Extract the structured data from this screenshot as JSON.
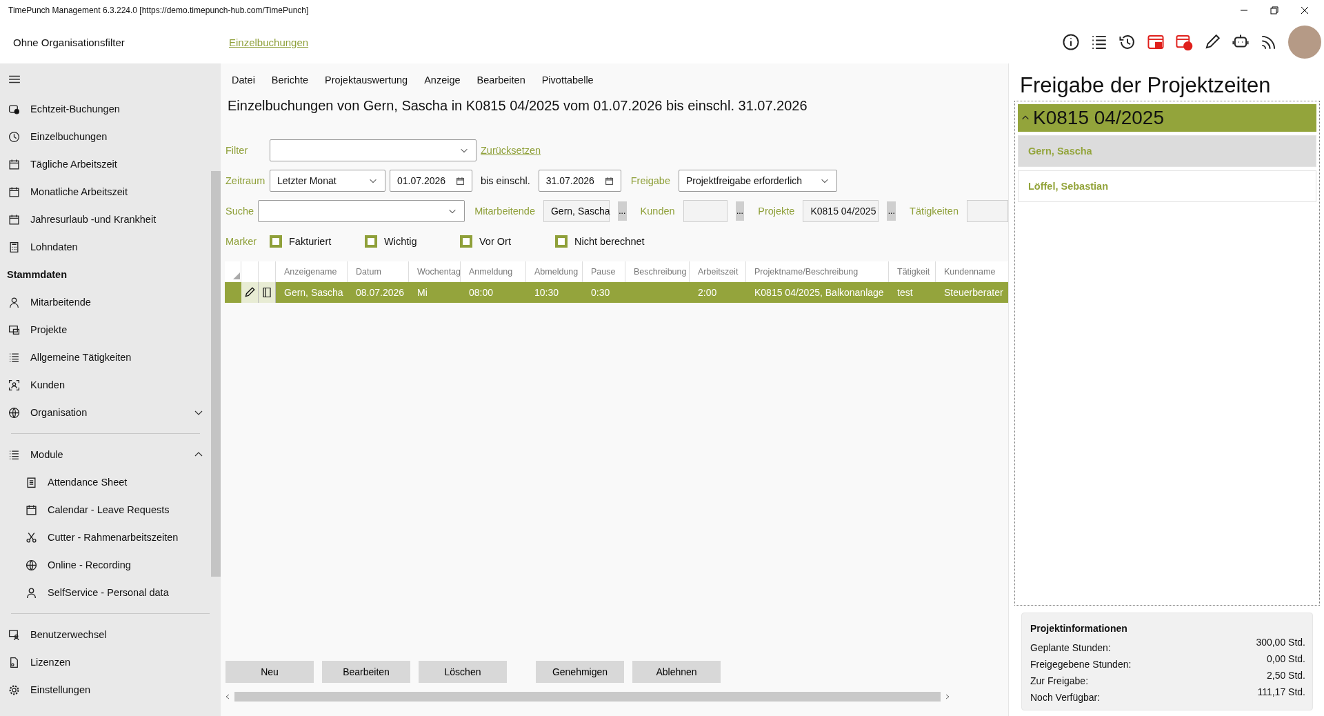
{
  "window": {
    "title": "TimePunch Management 6.3.224.0 [https://demo.timepunch-hub.com/TimePunch]"
  },
  "header": {
    "org_filter": "Ohne Organisationsfilter",
    "breadcrumb": "Einzelbuchungen"
  },
  "sidebar": {
    "items": [
      {
        "kind": "item",
        "label": "Echtzeit-Buchungen"
      },
      {
        "kind": "item",
        "label": "Einzelbuchungen"
      },
      {
        "kind": "item",
        "label": "Tägliche Arbeitszeit"
      },
      {
        "kind": "item",
        "label": "Monatliche Arbeitszeit"
      },
      {
        "kind": "item",
        "label": "Jahresurlaub -und Krankheit"
      },
      {
        "kind": "item",
        "label": "Lohndaten"
      },
      {
        "kind": "heading",
        "label": "Stammdaten"
      },
      {
        "kind": "item",
        "label": "Mitarbeitende"
      },
      {
        "kind": "item",
        "label": "Projekte"
      },
      {
        "kind": "item",
        "label": "Allgemeine Tätigkeiten"
      },
      {
        "kind": "item",
        "label": "Kunden"
      },
      {
        "kind": "group",
        "label": "Organisation",
        "expanded": false
      },
      {
        "kind": "group",
        "label": "Module",
        "expanded": true,
        "children": [
          {
            "label": "Attendance Sheet"
          },
          {
            "label": "Calendar - Leave Requests"
          },
          {
            "label": "Cutter - Rahmenarbeitszeiten"
          },
          {
            "label": "Online - Recording"
          },
          {
            "label": "SelfService - Personal data"
          }
        ]
      }
    ],
    "footer": [
      {
        "label": "Benutzerwechsel"
      },
      {
        "label": "Lizenzen"
      },
      {
        "label": "Einstellungen"
      }
    ]
  },
  "menu": [
    "Datei",
    "Berichte",
    "Projektauswertung",
    "Anzeige",
    "Bearbeiten",
    "Pivottabelle"
  ],
  "heading": "Einzelbuchungen von Gern, Sascha in K0815 04/2025 vom 01.07.2026 bis einschl. 31.07.2026",
  "filters": [
    [
      {
        "kind": "label",
        "text": "Filter"
      },
      {
        "kind": "combo"
      },
      {
        "kind": "link",
        "text": "Zurücksetzen"
      }
    ],
    [
      {
        "kind": "label",
        "text": "Zeitraum"
      },
      {
        "kind": "combo",
        "value": "Letzter Monat"
      },
      {
        "kind": "date",
        "value": "01.07.2026"
      },
      {
        "kind": "text",
        "text": "bis einschl."
      },
      {
        "kind": "date",
        "value": "31.07.2026"
      },
      {
        "kind": "label",
        "text": "Freigabe"
      },
      {
        "kind": "combo",
        "value": "Projektfreigabe erforderlich"
      }
    ],
    [
      {
        "kind": "label",
        "text": "Suche"
      },
      {
        "kind": "combo"
      },
      {
        "kind": "label",
        "text": "Mitarbeitende"
      },
      {
        "kind": "field",
        "value": "Gern, Sascha"
      },
      {
        "kind": "button",
        "text": "..."
      },
      {
        "kind": "label",
        "text": "Kunden"
      },
      {
        "kind": "field"
      },
      {
        "kind": "button",
        "text": "..."
      },
      {
        "kind": "label",
        "text": "Projekte"
      },
      {
        "kind": "field",
        "value": "K0815 04/2025"
      },
      {
        "kind": "button",
        "text": "..."
      },
      {
        "kind": "label",
        "text": "Tätigkeiten"
      },
      {
        "kind": "field"
      }
    ],
    [
      {
        "kind": "label",
        "text": "Marker"
      },
      {
        "kind": "checkbox",
        "text": "Fakturiert",
        "checked": false
      },
      {
        "kind": "checkbox",
        "text": "Wichtig",
        "checked": false
      },
      {
        "kind": "checkbox",
        "text": "Vor Ort",
        "checked": false
      },
      {
        "kind": "checkbox",
        "text": "Nicht berechnet",
        "checked": false
      }
    ]
  ],
  "table": {
    "columns": [
      "Anzeigename",
      "Datum",
      "Wochentag",
      "Anmeldung",
      "Abmeldung",
      "Pause",
      "Beschreibung",
      "Arbeitszeit",
      "Projektname/Beschreibung",
      "Tätigkeit",
      "Kundenname"
    ],
    "rows": [
      {
        "selected": true,
        "cells": [
          "Gern, Sascha",
          "08.07.2026",
          "Mi",
          "08:00",
          "10:30",
          "0:30",
          "",
          "2:00",
          "K0815 04/2025, Balkonanlage",
          "test",
          "Steuerberater"
        ]
      }
    ]
  },
  "buttons": [
    {
      "label": "Neu"
    },
    {
      "label": "Bearbeiten"
    },
    {
      "label": "Löschen"
    },
    {
      "label": "Genehmigen"
    },
    {
      "label": "Ablehnen"
    }
  ],
  "approval": {
    "title": "Freigabe der Projektzeiten",
    "group": {
      "label": "K0815 04/2025",
      "expanded": true
    },
    "employees": [
      {
        "name": "Gern, Sascha",
        "selected": true
      },
      {
        "name": "Löffel, Sebastian",
        "selected": false
      }
    ]
  },
  "project_info": {
    "title": "Projektinformationen",
    "rows": [
      {
        "label": "Geplante Stunden:",
        "value": "300,00 Std."
      },
      {
        "label": "Freigegebene Stunden:",
        "value": "0,00 Std."
      },
      {
        "label": "Zur Freigabe:",
        "value": "2,50 Std."
      },
      {
        "label": "Noch Verfügbar:",
        "value": "111,17 Std."
      }
    ]
  }
}
